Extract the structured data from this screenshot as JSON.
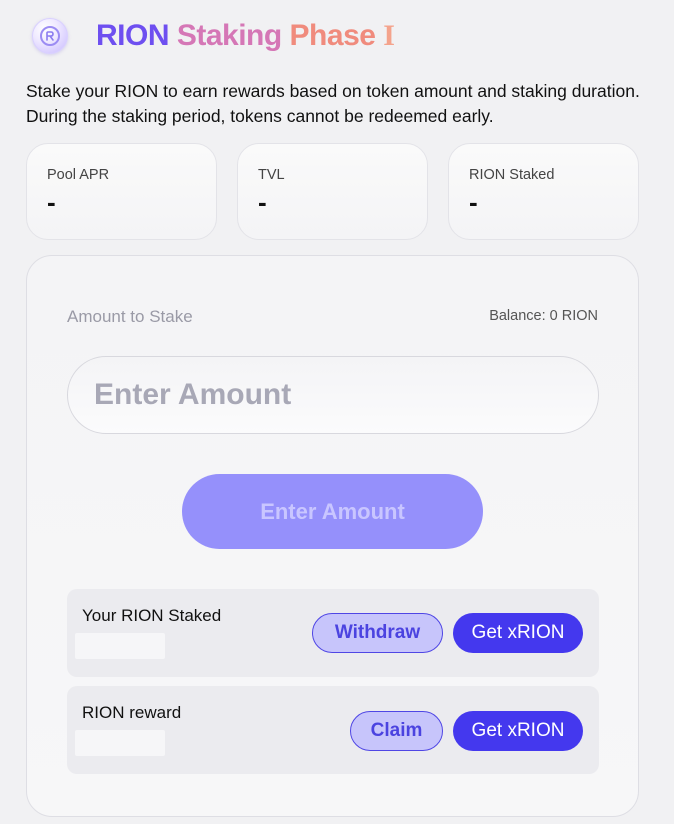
{
  "header": {
    "logo_icon": "rion-logo-icon",
    "title_rion": "RION",
    "title_staking": "Staking",
    "title_phase": "Phase",
    "title_numeral": "I"
  },
  "description": "Stake your RION to earn rewards based on token amount and staking duration. During the staking period, tokens cannot be redeemed early.",
  "stats": [
    {
      "label": "Pool APR",
      "value": "-"
    },
    {
      "label": "TVL",
      "value": "-"
    },
    {
      "label": "RION Staked",
      "value": "-"
    }
  ],
  "stake": {
    "amount_label": "Amount to Stake",
    "balance": "Balance: 0 RION",
    "input_placeholder": "Enter Amount",
    "input_value": "",
    "button_label": "Enter Amount"
  },
  "rows": {
    "staked": {
      "label": "Your RION Staked",
      "withdraw_label": "Withdraw",
      "get_label": "Get xRION"
    },
    "reward": {
      "label": "RION reward",
      "claim_label": "Claim",
      "get_label": "Get xRION"
    }
  },
  "colors": {
    "accent": "#4438ee",
    "accent_soft": "#9590fb",
    "title_gradient_start": "#6e4ff0",
    "title_gradient_end": "#f4a38c"
  }
}
